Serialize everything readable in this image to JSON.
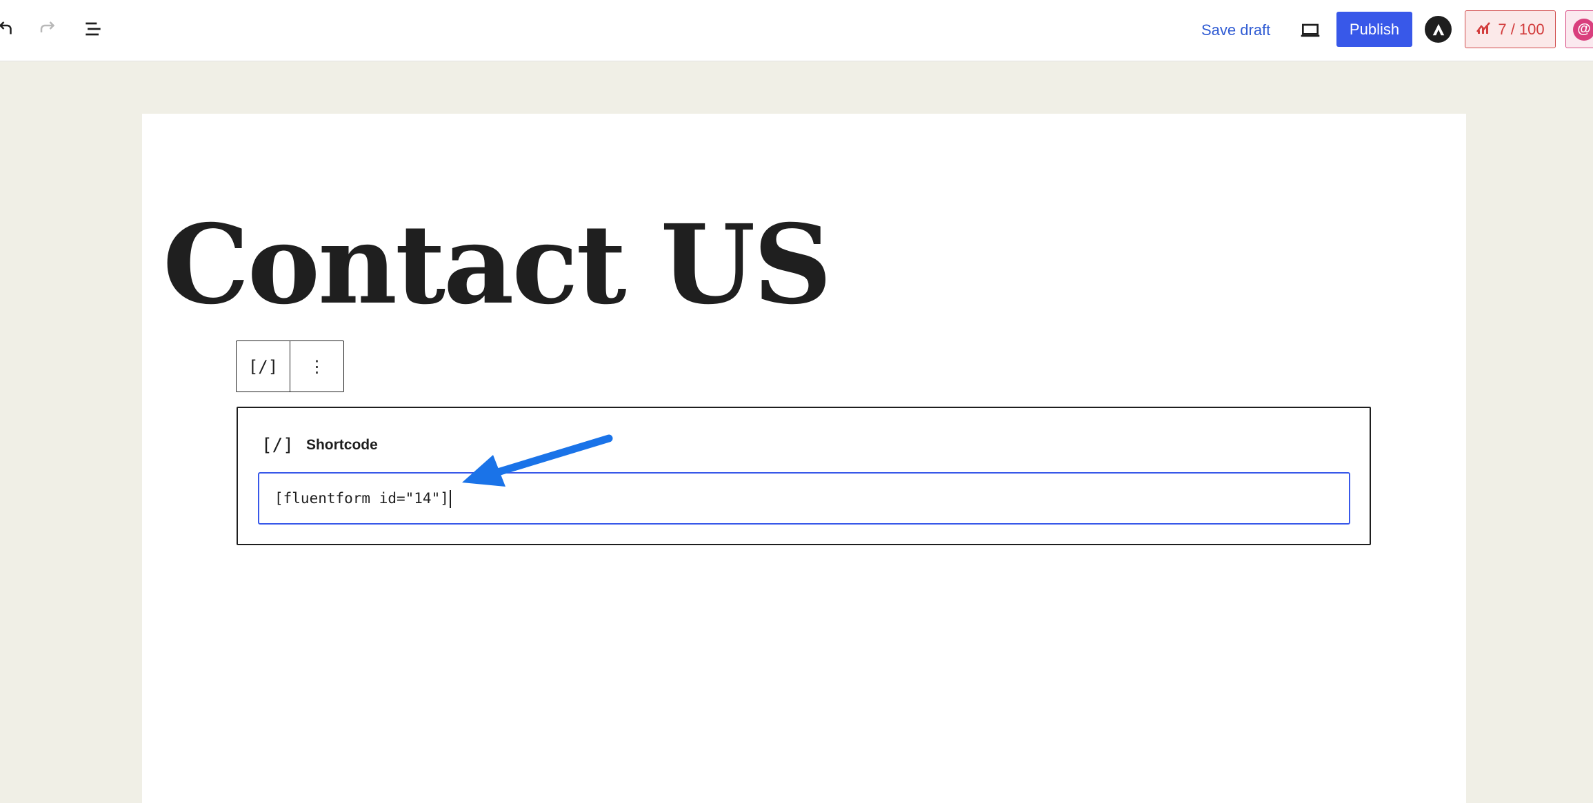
{
  "toolbar": {
    "undo_icon": "undo-icon",
    "redo_icon": "redo-icon",
    "document_overview_icon": "list-view-icon",
    "save_draft_label": "Save draft",
    "preview_icon": "desktop-preview-icon",
    "publish_label": "Publish",
    "astra_icon": "astra-logo-icon",
    "score_icon": "seo-score-icon",
    "score_label": "7 / 100",
    "ai_icon": "ai-assistant-icon",
    "ai_label": "@"
  },
  "post": {
    "title": "Contact US"
  },
  "block_toolbar": {
    "block_type_icon": "[/]",
    "options_icon": "⋮"
  },
  "shortcode_block": {
    "icon": "[/]",
    "label": "Shortcode",
    "value": "[fluentform id=\"14\"]"
  },
  "annotation": {
    "arrow_color": "#1a73e8"
  },
  "colors": {
    "accent": "#3858e9",
    "canvas_background": "#f0efe6",
    "score_red": "#d23b3b",
    "ai_pink": "#d93f7d"
  }
}
